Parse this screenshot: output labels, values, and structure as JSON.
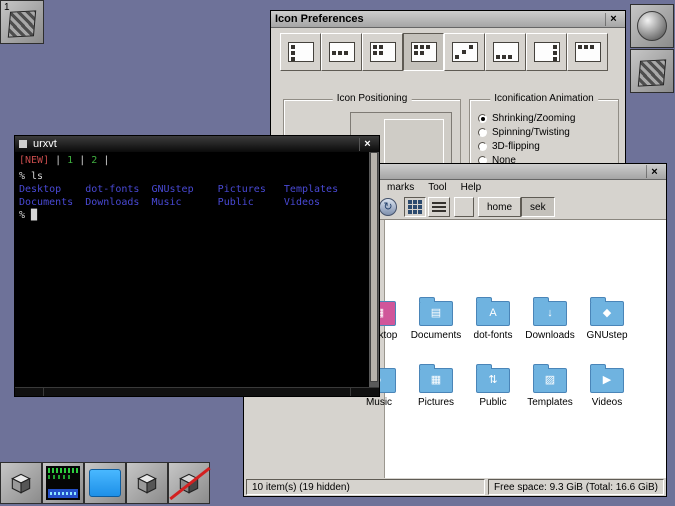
{
  "desktop": {
    "background": "#6e7299"
  },
  "clip": {
    "workspace_label": "1"
  },
  "icon_prefs": {
    "title": "Icon Preferences",
    "close_label": "×",
    "toolbar": {
      "selected_index": 3,
      "buttons": [
        "position-left-column",
        "position-middle-row",
        "position-top-left-block",
        "position-grid",
        "position-diagonal",
        "position-bottom-row",
        "position-right-column",
        "position-top-row"
      ]
    },
    "positioning_frame_label": "Icon Positioning",
    "animation_frame_label": "Iconification Animation",
    "animation_options": [
      {
        "label": "Shrinking/Zooming",
        "selected": true
      },
      {
        "label": "Spinning/Twisting",
        "selected": false
      },
      {
        "label": "3D-flipping",
        "selected": false
      },
      {
        "label": "None",
        "selected": false
      }
    ]
  },
  "terminal": {
    "title": "urxvt",
    "close_label": "×",
    "colors": {
      "red": "#c84c4c",
      "green": "#3fae3f",
      "white": "#d6d6d6",
      "blue": "#4949d4"
    },
    "lines": [
      [
        {
          "t": "[NEW]",
          "c": "red"
        },
        {
          "t": " | ",
          "c": "white"
        },
        {
          "t": "1",
          "c": "green"
        },
        {
          "t": " | ",
          "c": "white"
        },
        {
          "t": "2",
          "c": "green"
        },
        {
          "t": " |",
          "c": "white"
        }
      ],
      [
        {
          "t": "% ls",
          "c": "white"
        }
      ],
      [
        {
          "t": "Desktop    dot-fonts  GNUstep    Pictures   Templates",
          "c": "blue"
        }
      ],
      [
        {
          "t": "Documents  Downloads  Music      Public     Videos",
          "c": "blue"
        }
      ],
      [
        {
          "t": "% ",
          "c": "white"
        },
        {
          "t": "█",
          "c": "white"
        }
      ]
    ]
  },
  "file_manager": {
    "close_label": "×",
    "menu_items": [
      "marks",
      "Tool",
      "Help"
    ],
    "path_buttons": [
      {
        "label": "home",
        "active": false
      },
      {
        "label": "sek",
        "active": true
      }
    ],
    "folder_colors": {
      "default": "#6fb3e0",
      "desktop": "#d0569a"
    },
    "folders": [
      {
        "name": "Desktop",
        "col": 0,
        "row": 0,
        "color": "#d0569a",
        "glyph": "▦"
      },
      {
        "name": "Documents",
        "col": 1,
        "row": 0,
        "color": "#6fb3e0",
        "glyph": "▤"
      },
      {
        "name": "dot-fonts",
        "col": 2,
        "row": 0,
        "color": "#6fb3e0",
        "glyph": "A"
      },
      {
        "name": "Downloads",
        "col": 3,
        "row": 0,
        "color": "#6fb3e0",
        "glyph": "↓"
      },
      {
        "name": "GNUstep",
        "col": 4,
        "row": 0,
        "color": "#6fb3e0",
        "glyph": "◆"
      },
      {
        "name": "Music",
        "col": 0,
        "row": 1,
        "color": "#6fb3e0",
        "glyph": "♪"
      },
      {
        "name": "Pictures",
        "col": 1,
        "row": 1,
        "color": "#6fb3e0",
        "glyph": "▦"
      },
      {
        "name": "Public",
        "col": 2,
        "row": 1,
        "color": "#6fb3e0",
        "glyph": "⇅"
      },
      {
        "name": "Templates",
        "col": 3,
        "row": 1,
        "color": "#6fb3e0",
        "glyph": "▨"
      },
      {
        "name": "Videos",
        "col": 4,
        "row": 1,
        "color": "#6fb3e0",
        "glyph": "▶"
      }
    ],
    "status_left": "10 item(s) (19 hidden)",
    "status_right": "Free space: 9.3 GiB (Total: 16.6 GiB)"
  }
}
